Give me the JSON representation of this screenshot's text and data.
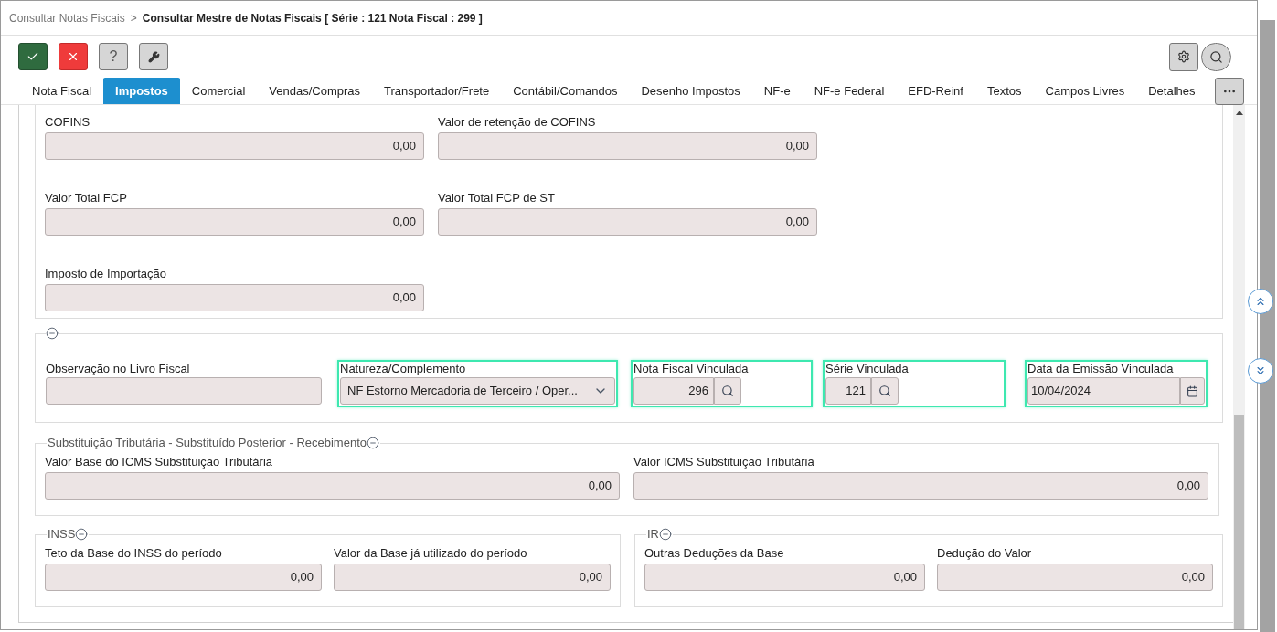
{
  "breadcrumb": {
    "parent": "Consultar Notas Fiscais",
    "separator": ">",
    "current": "Consultar Mestre de Notas Fiscais [ Série : 121 Nota Fiscal : 299 ]"
  },
  "toolbar": [
    {
      "kind": "confirm"
    },
    {
      "kind": "cancel"
    },
    {
      "kind": "help",
      "label": "?"
    },
    {
      "kind": "tools"
    }
  ],
  "tabs": [
    {
      "label": "Nota Fiscal",
      "selected": false
    },
    {
      "label": "Impostos",
      "selected": true
    },
    {
      "label": "Comercial",
      "selected": false
    },
    {
      "label": "Vendas/Compras",
      "selected": false
    },
    {
      "label": "Transportador/Frete",
      "selected": false
    },
    {
      "label": "Contábil/Comandos",
      "selected": false
    },
    {
      "label": "Desenho Impostos",
      "selected": false
    },
    {
      "label": "NF-e",
      "selected": false
    },
    {
      "label": "NF-e Federal",
      "selected": false
    },
    {
      "label": "EFD-Reinf",
      "selected": false
    },
    {
      "label": "Textos",
      "selected": false
    },
    {
      "label": "Campos Livres",
      "selected": false
    },
    {
      "label": "Detalhes",
      "selected": false
    }
  ],
  "tax_panel": {
    "rows": [
      [
        {
          "label": "COFINS",
          "value": "0,00"
        },
        {
          "label": "Valor de retenção de COFINS",
          "value": "0,00"
        }
      ],
      [
        {
          "label": "Valor Total FCP",
          "value": "0,00"
        },
        {
          "label": "Valor Total FCP de ST",
          "value": "0,00"
        }
      ],
      [
        {
          "label": "Imposto de Importação",
          "value": "0,00"
        }
      ]
    ]
  },
  "linked_section": {
    "expanded": true,
    "fields": [
      {
        "kind": "text",
        "label": "Observação no Livro Fiscal",
        "highlighted": false
      },
      {
        "kind": "select",
        "label": "Natureza/Complemento",
        "value": "NF Estorno Mercadoria de Terceiro / Oper...",
        "highlighted": true
      },
      {
        "kind": "lookup",
        "label": "Nota Fiscal Vinculada",
        "value": "296",
        "highlighted": true
      },
      {
        "kind": "lookup",
        "label": "Série Vinculada",
        "value": "121",
        "highlighted": true
      },
      {
        "kind": "date",
        "label": "Data da Emissão Vinculada",
        "value": "10/04/2024",
        "highlighted": true
      }
    ]
  },
  "st_fieldset": {
    "title": "Substituição Tributária - Substituído Posterior - Recebimento",
    "expanded": true,
    "fields": [
      {
        "label": "Valor Base do ICMS Substituição Tributária",
        "value": "0,00"
      },
      {
        "label": "Valor ICMS Substituição Tributária",
        "value": "0,00"
      }
    ]
  },
  "bottom_fieldsets": [
    {
      "title": "INSS",
      "expanded": true,
      "fields": [
        {
          "label": "Teto da Base do INSS do período",
          "value": "0,00"
        },
        {
          "label": "Valor da Base já utilizado do período",
          "value": "0,00"
        }
      ]
    },
    {
      "title": "IR",
      "expanded": true,
      "fields": [
        {
          "label": "Outras Deduções da Base",
          "value": "0,00"
        },
        {
          "label": "Dedução do Valor",
          "value": "0,00"
        }
      ]
    }
  ]
}
